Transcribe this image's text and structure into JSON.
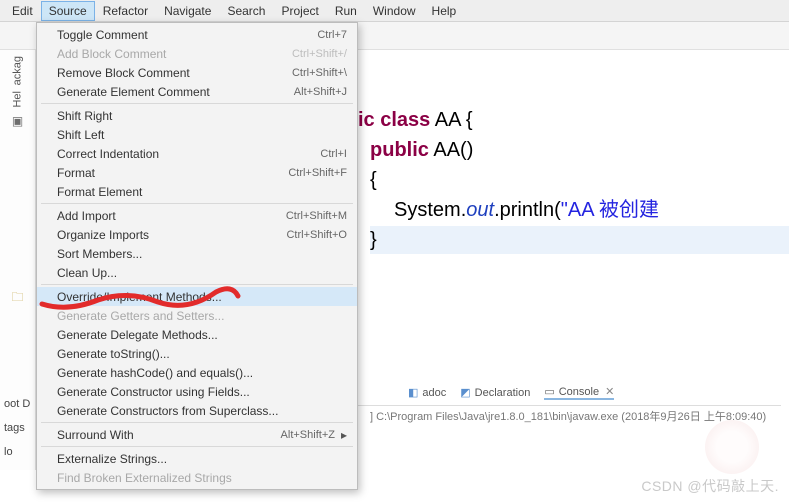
{
  "menubar": {
    "items": [
      "Edit",
      "Source",
      "Refactor",
      "Navigate",
      "Search",
      "Project",
      "Run",
      "Window",
      "Help"
    ],
    "active_index": 1
  },
  "left": {
    "tab0": "ackag",
    "tab1": "Hel"
  },
  "dropdown": {
    "items": [
      {
        "label": "Toggle Comment",
        "shortcut": "Ctrl+7",
        "sep": false
      },
      {
        "label": "Add Block Comment",
        "shortcut": "Ctrl+Shift+/",
        "disabled": true,
        "sep": false
      },
      {
        "label": "Remove Block Comment",
        "shortcut": "Ctrl+Shift+\\",
        "sep": false
      },
      {
        "label": "Generate Element Comment",
        "shortcut": "Alt+Shift+J",
        "sep": true
      },
      {
        "label": "Shift Right",
        "sep": false
      },
      {
        "label": "Shift Left",
        "sep": false
      },
      {
        "label": "Correct Indentation",
        "shortcut": "Ctrl+I",
        "sep": false
      },
      {
        "label": "Format",
        "shortcut": "Ctrl+Shift+F",
        "sep": false
      },
      {
        "label": "Format Element",
        "sep": true
      },
      {
        "label": "Add Import",
        "shortcut": "Ctrl+Shift+M",
        "sep": false
      },
      {
        "label": "Organize Imports",
        "shortcut": "Ctrl+Shift+O",
        "sep": false
      },
      {
        "label": "Sort Members...",
        "sep": false
      },
      {
        "label": "Clean Up...",
        "sep": true
      },
      {
        "label": "Override/Implement Methods...",
        "highlight": true,
        "sep": false
      },
      {
        "label": "Generate Getters and Setters...",
        "disabled": true,
        "sep": false
      },
      {
        "label": "Generate Delegate Methods...",
        "sep": false
      },
      {
        "label": "Generate toString()...",
        "sep": false
      },
      {
        "label": "Generate hashCode() and equals()...",
        "sep": false
      },
      {
        "label": "Generate Constructor using Fields...",
        "sep": false
      },
      {
        "label": "Generate Constructors from Superclass...",
        "sep": true
      },
      {
        "label": "Surround With",
        "shortcut": "Alt+Shift+Z",
        "submenu": true,
        "sep": true
      },
      {
        "label": "Externalize Strings...",
        "sep": false
      },
      {
        "label": "Find Broken Externalized Strings",
        "disabled": true,
        "sep": false
      }
    ]
  },
  "editor": {
    "line1_kw": "ic class",
    "line1_cls": " AA ",
    "line1_brace": "{",
    "line2_kw": "public",
    "line2_ctor": " AA()",
    "line3": "{",
    "line4_obj": "System.",
    "line4_field": "out",
    "line4_call": ".println(",
    "line4_str": "\"AA 被创建",
    "line5": "}"
  },
  "bottom_tabs": {
    "tab1": "adoc",
    "tab2": "Declaration",
    "tab3": "Console",
    "close": "✕"
  },
  "console": {
    "text": "] C:\\Program Files\\Java\\jre1.8.0_181\\bin\\javaw.exe (2018年9月26日 上午8:09:40)"
  },
  "bottom_left": {
    "l1": "oot D",
    "l2": "tags",
    "l3": "lo"
  },
  "watermark": "CSDN @代码敲上天."
}
